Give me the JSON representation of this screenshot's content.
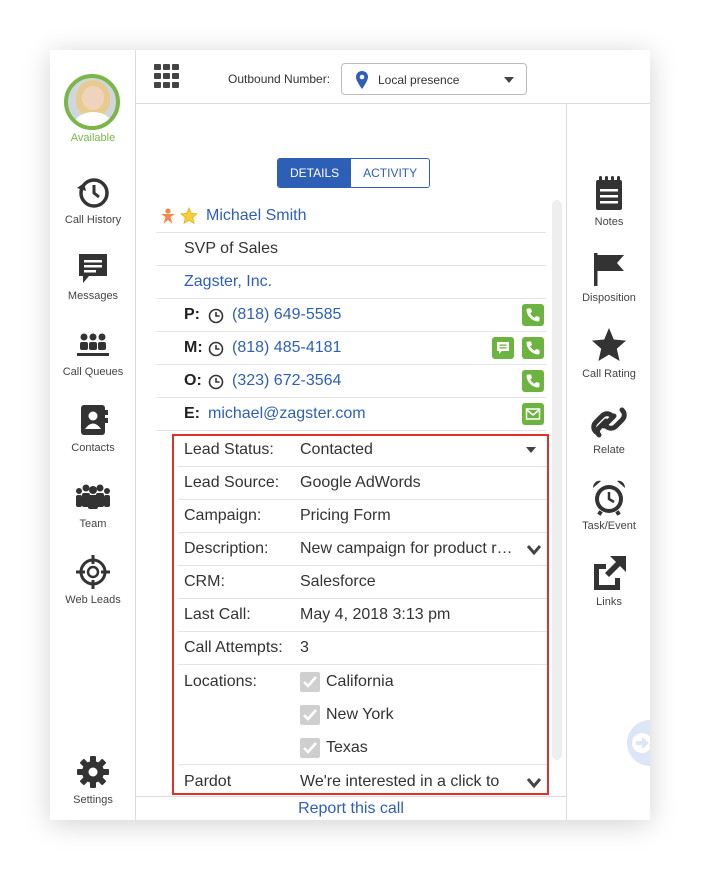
{
  "status": {
    "label": "Available",
    "color": "#7ab648"
  },
  "left_nav": [
    {
      "label": "Call History",
      "icon": "history-icon"
    },
    {
      "label": "Messages",
      "icon": "message-icon"
    },
    {
      "label": "Call Queues",
      "icon": "call-queues-icon"
    },
    {
      "label": "Contacts",
      "icon": "contacts-icon"
    },
    {
      "label": "Team",
      "icon": "team-icon"
    },
    {
      "label": "Web Leads",
      "icon": "crosshair-icon"
    },
    {
      "label": "Settings",
      "icon": "gear-icon"
    }
  ],
  "right_nav": [
    {
      "label": "Notes",
      "icon": "notepad-icon"
    },
    {
      "label": "Disposition",
      "icon": "flag-icon"
    },
    {
      "label": "Call Rating",
      "icon": "star-icon"
    },
    {
      "label": "Relate",
      "icon": "link-icon"
    },
    {
      "label": "Task/Event",
      "icon": "alarm-clock-icon"
    },
    {
      "label": "Links",
      "icon": "external-link-icon"
    }
  ],
  "top_bar": {
    "outbound_label": "Outbound Number:",
    "outbound_value": "Local presence"
  },
  "tabs": [
    {
      "label": "DETAILS",
      "active": true
    },
    {
      "label": "ACTIVITY",
      "active": false
    }
  ],
  "contact": {
    "name": "Michael Smith",
    "title": "SVP of Sales",
    "company": "Zagster, Inc.",
    "phones": [
      {
        "label": "P:",
        "number": "(818) 649-5585"
      },
      {
        "label": "M:",
        "number": "(818) 485-4181"
      },
      {
        "label": "O:",
        "number": "(323) 672-3564"
      }
    ],
    "email_label": "E:",
    "email": "michael@zagster.com"
  },
  "fields": [
    {
      "label": "Lead Status:",
      "value": "Contacted"
    },
    {
      "label": "Lead Source:",
      "value": "Google AdWords"
    },
    {
      "label": "Campaign:",
      "value": "Pricing Form"
    },
    {
      "label": "Description:",
      "value": "New campaign for product r…"
    },
    {
      "label": "CRM:",
      "value": "Salesforce"
    },
    {
      "label": "Last Call:",
      "value": "May 4, 2018 3:13 pm"
    },
    {
      "label": "Call Attempts:",
      "value": "3"
    },
    {
      "label": "Locations:",
      "value": ""
    },
    {
      "label": "Pardot",
      "value": "We're interested in a click to"
    }
  ],
  "locations": [
    "California",
    "New York",
    "Texas"
  ],
  "footer": {
    "report_label": "Report this call"
  },
  "colors": {
    "accent": "#2e5fb7",
    "action_green": "#6cb33f",
    "highlight_red": "#e0302a"
  }
}
